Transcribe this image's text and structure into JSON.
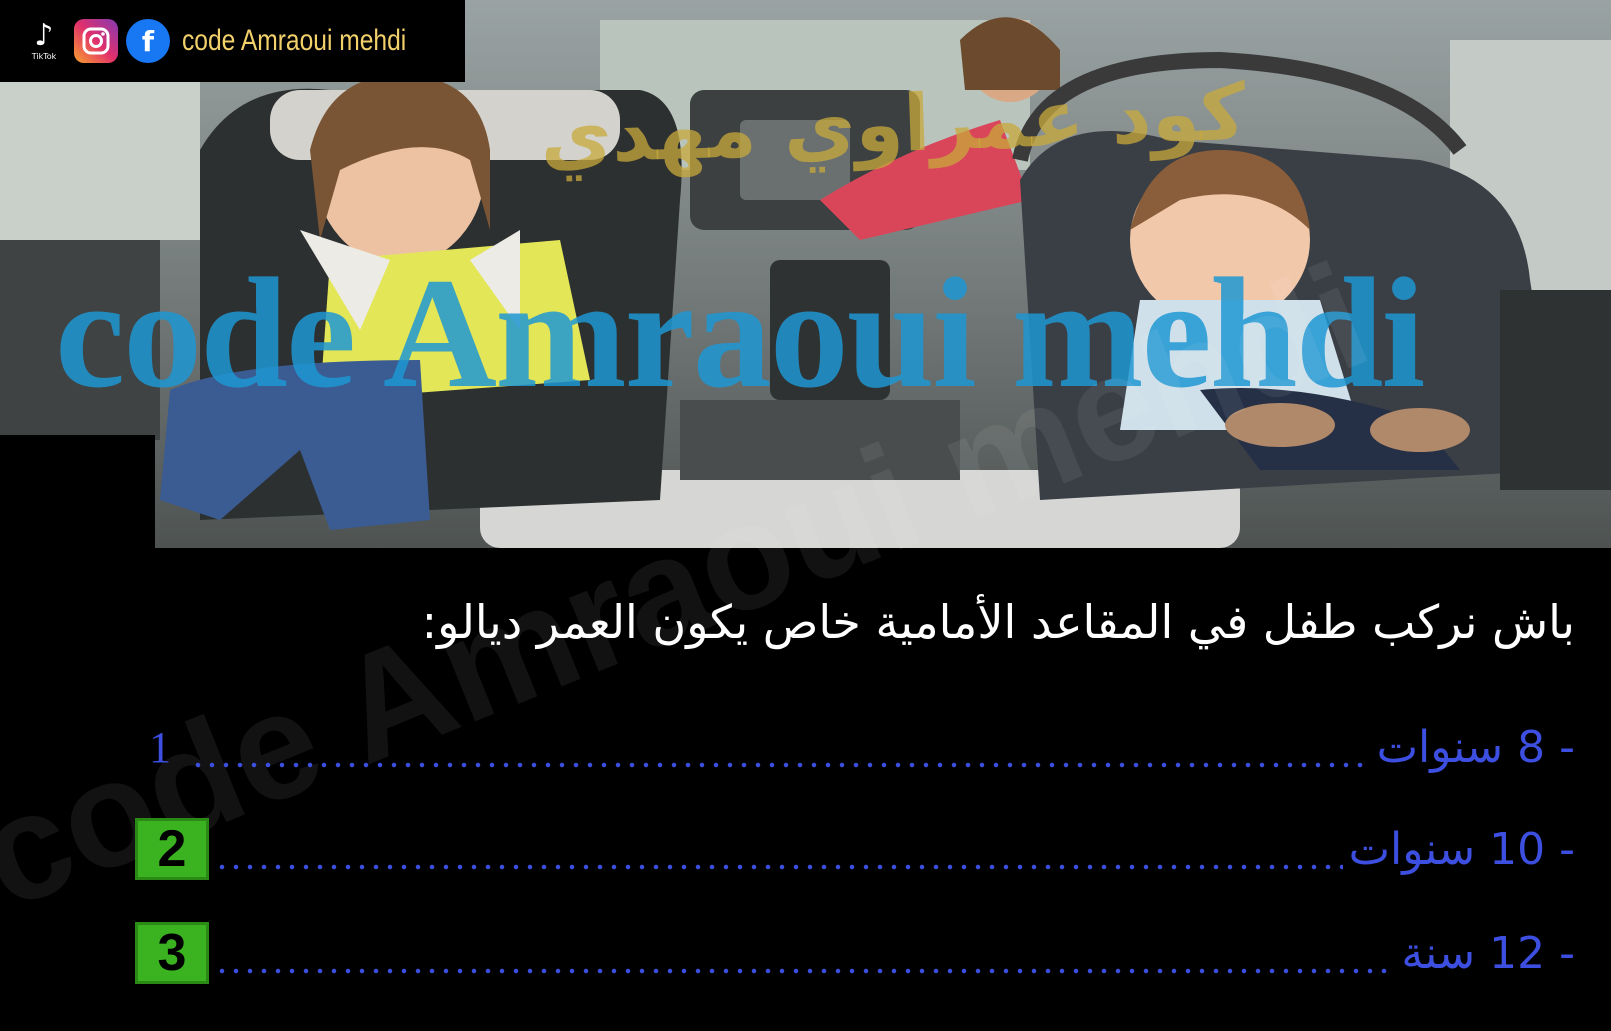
{
  "social": {
    "handle": "code Amraoui mehdi",
    "tiktok_label": "TikTok",
    "icons": [
      "tiktok-icon",
      "instagram-icon",
      "facebook-icon"
    ]
  },
  "watermarks": {
    "arabic": "كود عمراوي مهدي",
    "latin": "code Amraoui mehdi",
    "bottom": "code Amraoui mehdi"
  },
  "question": {
    "text": "باش نركب طفل في المقاعد الأمامية خاص يكون العمر ديالو:"
  },
  "options": [
    {
      "text": "- 8 سنوات",
      "marker": "1",
      "style": "number"
    },
    {
      "text": "- 10 سنوات",
      "marker": "2",
      "style": "badge"
    },
    {
      "text": "- 12 سنة",
      "marker": "3",
      "style": "badge"
    }
  ],
  "colors": {
    "option_blue": "#3d4fe0",
    "badge_green": "#3bb321",
    "handle_gold": "#f2d16b",
    "watermark_blue": "#1e96d2"
  }
}
